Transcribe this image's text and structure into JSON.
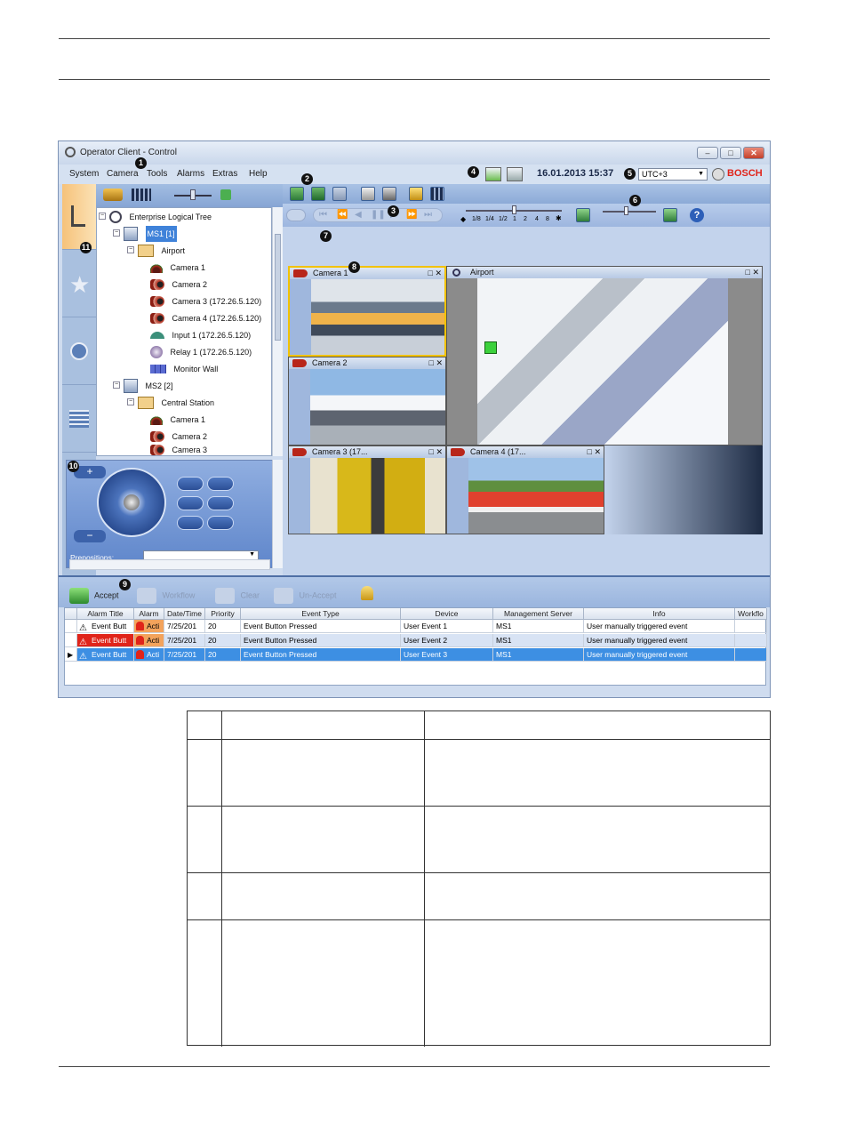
{
  "window": {
    "title": "Operator Client - Control",
    "controls": [
      "–",
      "□",
      "✕"
    ]
  },
  "menu": [
    "System",
    "Camera",
    "Tools",
    "Alarms",
    "Extras",
    "Help"
  ],
  "status": {
    "datetime": "16.01.2013 15:37",
    "timezone": "UTC+3",
    "brand": "BOSCH"
  },
  "callouts": [
    "1",
    "2",
    "3",
    "4",
    "5",
    "6",
    "7",
    "8",
    "9",
    "10",
    "11"
  ],
  "playback": {
    "speeds": [
      "1/8",
      "1/4",
      "1/2",
      "1",
      "2",
      "4",
      "8"
    ]
  },
  "tree": {
    "items": [
      {
        "label": "Enterprise Logical Tree",
        "icon": "enterprise-icon"
      },
      {
        "label": "MS1 [1]",
        "icon": "server-icon"
      },
      {
        "label": "Airport",
        "icon": "site-icon"
      },
      {
        "label": "Camera 1",
        "icon": "dome-camera-icon"
      },
      {
        "label": "Camera 2",
        "icon": "camera-icon"
      },
      {
        "label": "Camera 3 (172.26.5.120)",
        "icon": "camera-icon"
      },
      {
        "label": "Camera 4 (172.26.5.120)",
        "icon": "camera-icon"
      },
      {
        "label": "Input 1 (172.26.5.120)",
        "icon": "input-icon"
      },
      {
        "label": "Relay 1 (172.26.5.120)",
        "icon": "relay-icon"
      },
      {
        "label": "Monitor Wall",
        "icon": "monitor-wall-icon"
      },
      {
        "label": "MS2 [2]",
        "icon": "server-icon"
      },
      {
        "label": "Central Station",
        "icon": "site-icon"
      },
      {
        "label": "Camera 1",
        "icon": "dome-camera-icon"
      },
      {
        "label": "Camera 2",
        "icon": "camera-icon"
      },
      {
        "label": "Camera 3",
        "icon": "camera-icon"
      }
    ]
  },
  "ptz": {
    "prepositions_label": "Prepositions:",
    "zoom_in": "+",
    "zoom_out": "−"
  },
  "tiles": [
    {
      "title": "Camera 1"
    },
    {
      "title": "Airport"
    },
    {
      "title": "Camera 2"
    },
    {
      "title": "Camera 3 (17..."
    },
    {
      "title": "Camera 4 (17..."
    }
  ],
  "alarm_toolbar": {
    "accept": "Accept",
    "workflow": "Workflow",
    "clear": "Clear",
    "unaccept": "Un-Accept"
  },
  "alarm_table": {
    "columns": [
      "Alarm Title",
      "Alarm",
      "Date/Time",
      "Priority",
      "Event Type",
      "Device",
      "Management Server",
      "Info",
      "Workflo"
    ],
    "rows": [
      [
        "Event Butt",
        "Acti",
        "7/25/201",
        "20",
        "Event Button Pressed",
        "User Event 1",
        "MS1",
        "User manually triggered event",
        ""
      ],
      [
        "Event Butt",
        "Acti",
        "7/25/201",
        "20",
        "Event Button Pressed",
        "User Event 2",
        "MS1",
        "User manually triggered event",
        ""
      ],
      [
        "Event Butt",
        "Acti",
        "7/25/201",
        "20",
        "Event Button Pressed",
        "User Event 3",
        "MS1",
        "User manually triggered event",
        ""
      ]
    ]
  },
  "colors": {
    "accent": "#3d8fe3",
    "alarm_red": "#e0241a",
    "window_bg": "#cfdcef"
  }
}
